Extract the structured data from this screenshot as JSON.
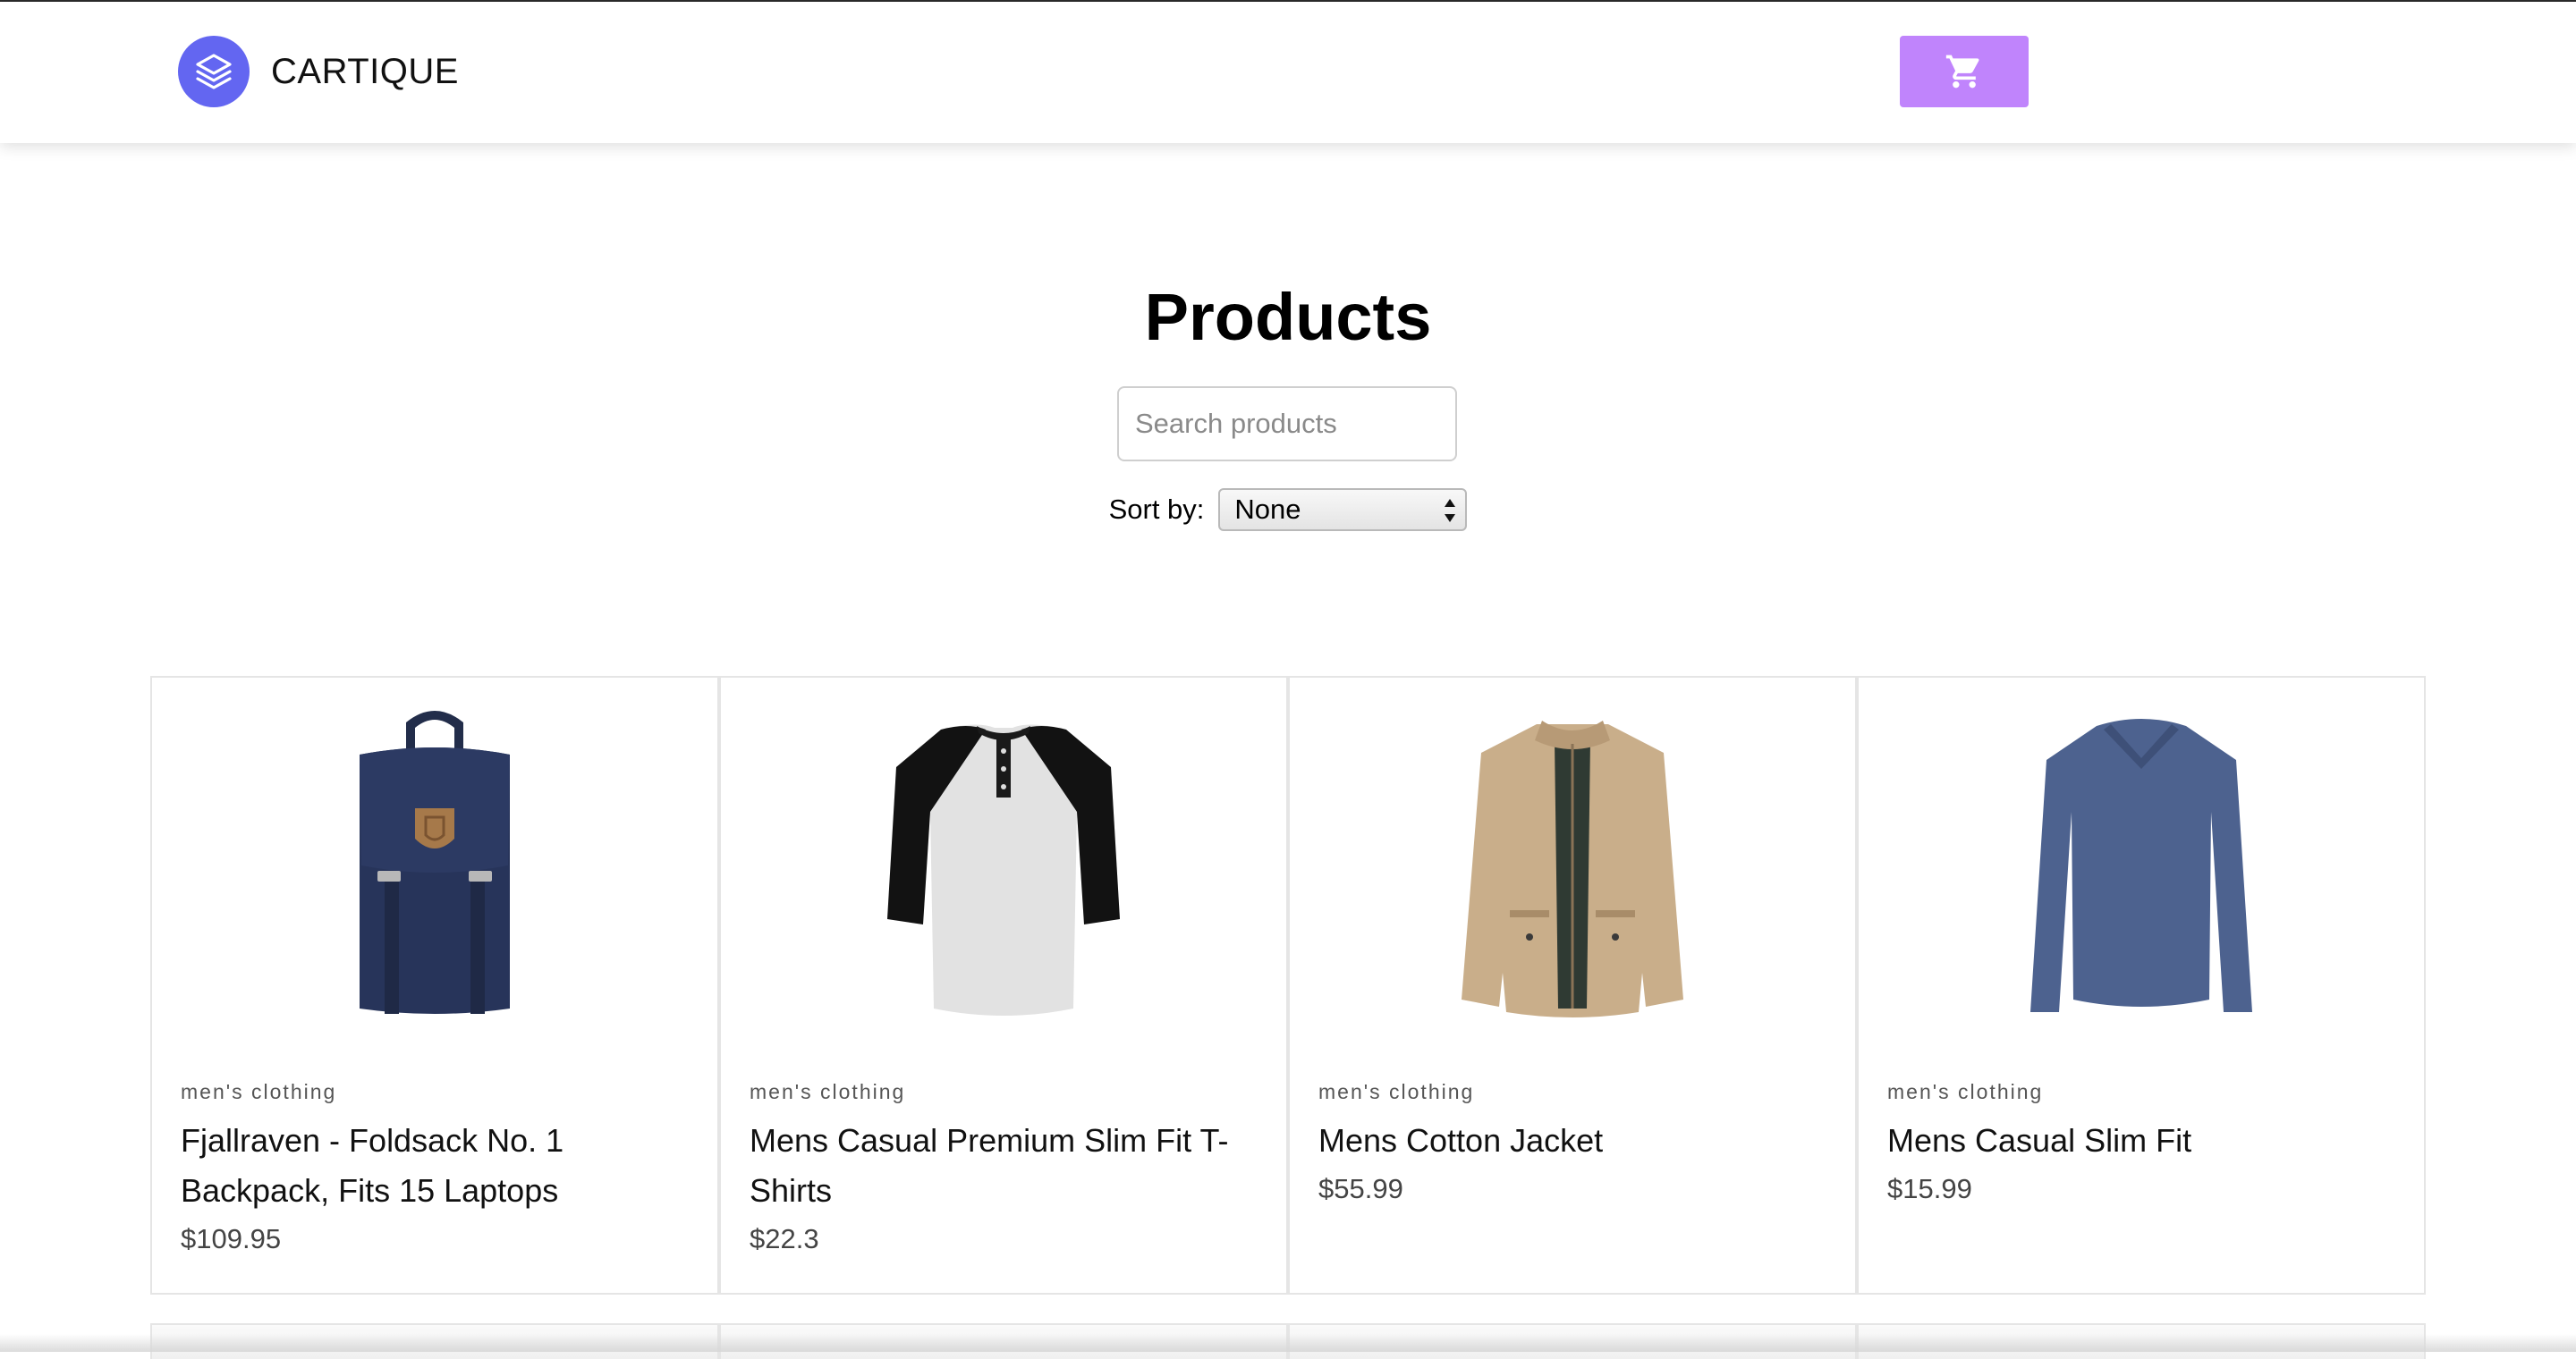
{
  "header": {
    "brand": "CARTIQUE",
    "logo_icon": "layers-icon",
    "cart_icon": "cart-icon",
    "accent_color": "#6366f1",
    "cart_button_color": "#c084fc"
  },
  "main": {
    "title": "Products",
    "search": {
      "placeholder": "Search products",
      "value": ""
    },
    "sort": {
      "label": "Sort by:",
      "selected": "None"
    }
  },
  "products": [
    {
      "category": "men's clothing",
      "name": "Fjallraven - Foldsack No. 1 Backpack, Fits 15 Laptops",
      "price": "$109.95",
      "image_icon": "backpack-image"
    },
    {
      "category": "men's clothing",
      "name": "Mens Casual Premium Slim Fit T-Shirts",
      "price": "$22.3",
      "image_icon": "raglan-tshirt-image"
    },
    {
      "category": "men's clothing",
      "name": "Mens Cotton Jacket",
      "price": "$55.99",
      "image_icon": "jacket-image"
    },
    {
      "category": "men's clothing",
      "name": "Mens Casual Slim Fit",
      "price": "$15.99",
      "image_icon": "long-sleeve-shirt-image"
    }
  ]
}
